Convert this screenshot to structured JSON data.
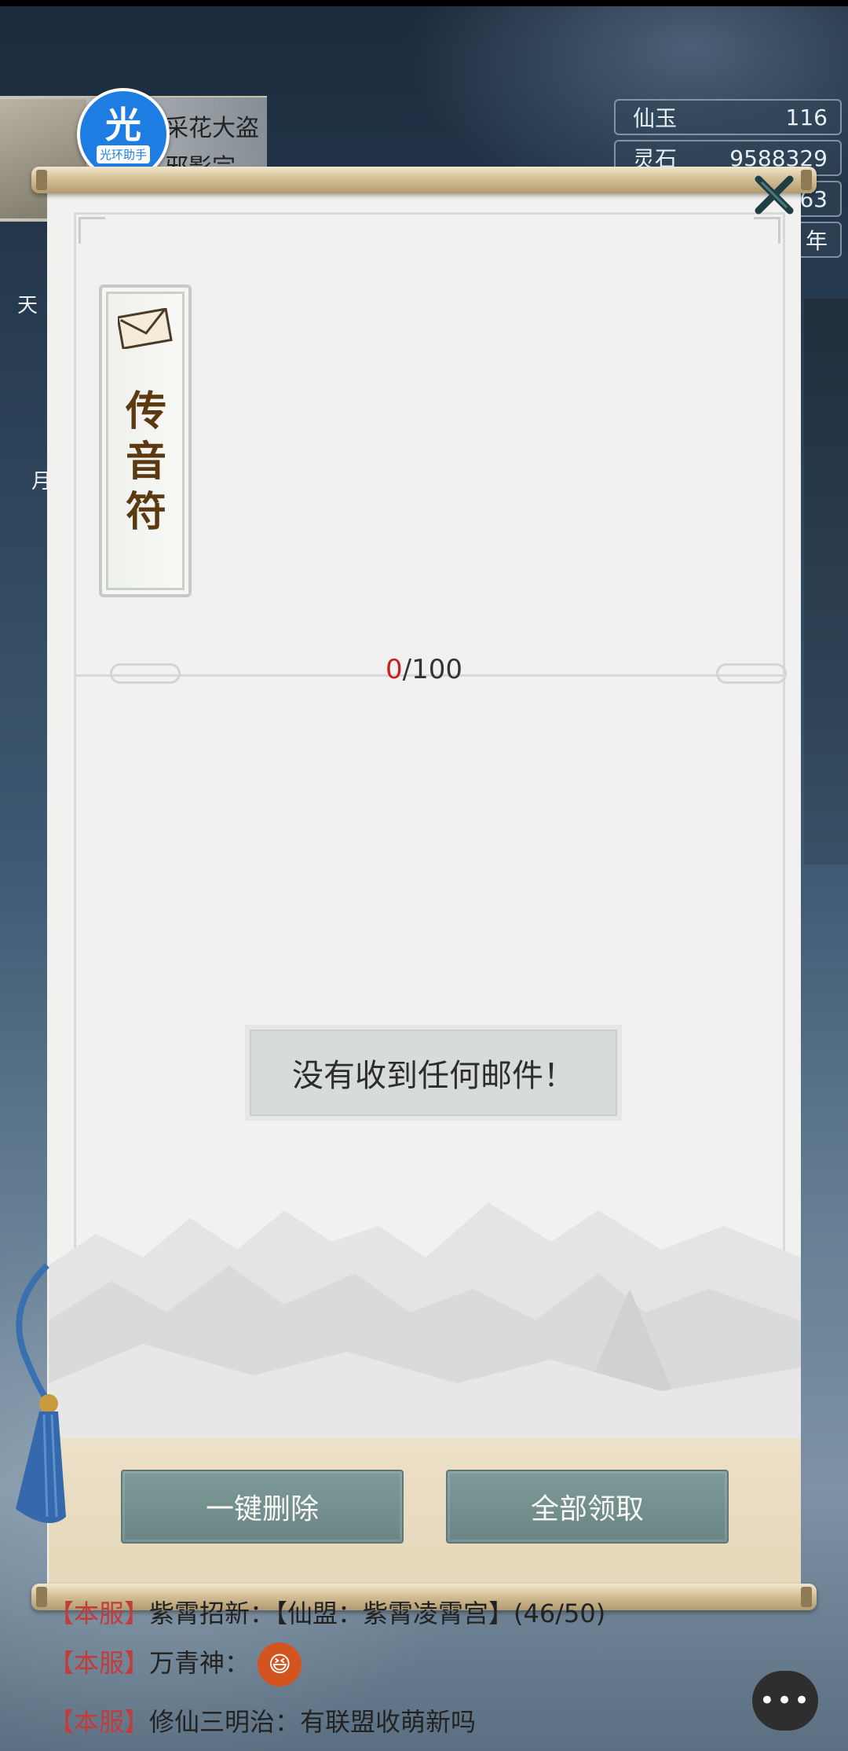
{
  "player": {
    "name": "采花大盗",
    "sect": "邪影宗",
    "helper_badge": {
      "big": "光",
      "small": "光环助手"
    }
  },
  "resources": [
    {
      "label": "仙玉",
      "value": "116"
    },
    {
      "label": "灵石",
      "value": "9588329"
    },
    {
      "label": "",
      "value": "63"
    },
    {
      "label": "",
      "value": "年"
    }
  ],
  "side_labels": {
    "left_top": "天",
    "left_mid": "月"
  },
  "mail": {
    "tab_title": "传音符",
    "count_current": "0",
    "count_max": "/100",
    "empty_message": "没有收到任何邮件！",
    "delete_all_label": "一键删除",
    "claim_all_label": "全部领取"
  },
  "chat": [
    {
      "channel": "【本服】",
      "text": "紫霄招新：【仙盟：紫霄凌霄宫】(46/50)"
    },
    {
      "channel": "【本服】",
      "text": "万青神："
    },
    {
      "channel": "【本服】",
      "text": "修仙三明治：有联盟收萌新吗"
    }
  ],
  "chat_button": "•••",
  "colors": {
    "button_bg": "#7e9a99",
    "count_highlight": "#c91f1f",
    "tab_text": "#5b3a12"
  }
}
